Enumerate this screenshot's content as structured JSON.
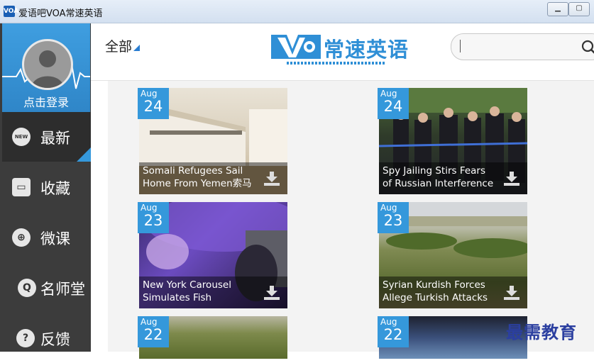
{
  "window": {
    "title": "爱语吧VOA常速英语",
    "icon_label": "VOA"
  },
  "sidebar": {
    "login_label": "点击登录",
    "items": [
      {
        "label": "最新",
        "icon": "new-badge-icon",
        "active": true
      },
      {
        "label": "收藏",
        "icon": "box-icon"
      },
      {
        "label": "微课",
        "icon": "crosshair-icon"
      },
      {
        "label": "名师堂",
        "icon": "q-icon"
      },
      {
        "label": "反馈",
        "icon": "question-icon"
      }
    ]
  },
  "header": {
    "filter_label": "全部",
    "logo_mark": "VOA",
    "logo_text": "常速英语",
    "search_placeholder": ""
  },
  "articles": [
    {
      "month": "Aug",
      "day": "24",
      "title": "Somali Refugees Sail Home From Yemen索马"
    },
    {
      "month": "Aug",
      "day": "24",
      "title": "Spy Jailing Stirs Fears of Russian Interference"
    },
    {
      "month": "Aug",
      "day": "23",
      "title": "New York Carousel Simulates Fish"
    },
    {
      "month": "Aug",
      "day": "23",
      "title": "Syrian Kurdish Forces Allege Turkish Attacks"
    },
    {
      "month": "Aug",
      "day": "22",
      "title": ""
    },
    {
      "month": "Aug",
      "day": "22",
      "title": ""
    }
  ],
  "watermark": "最需教育",
  "colors": {
    "accent": "#3598db",
    "sidebar": "#3c3c3c",
    "logo": "#2f8fd6"
  }
}
